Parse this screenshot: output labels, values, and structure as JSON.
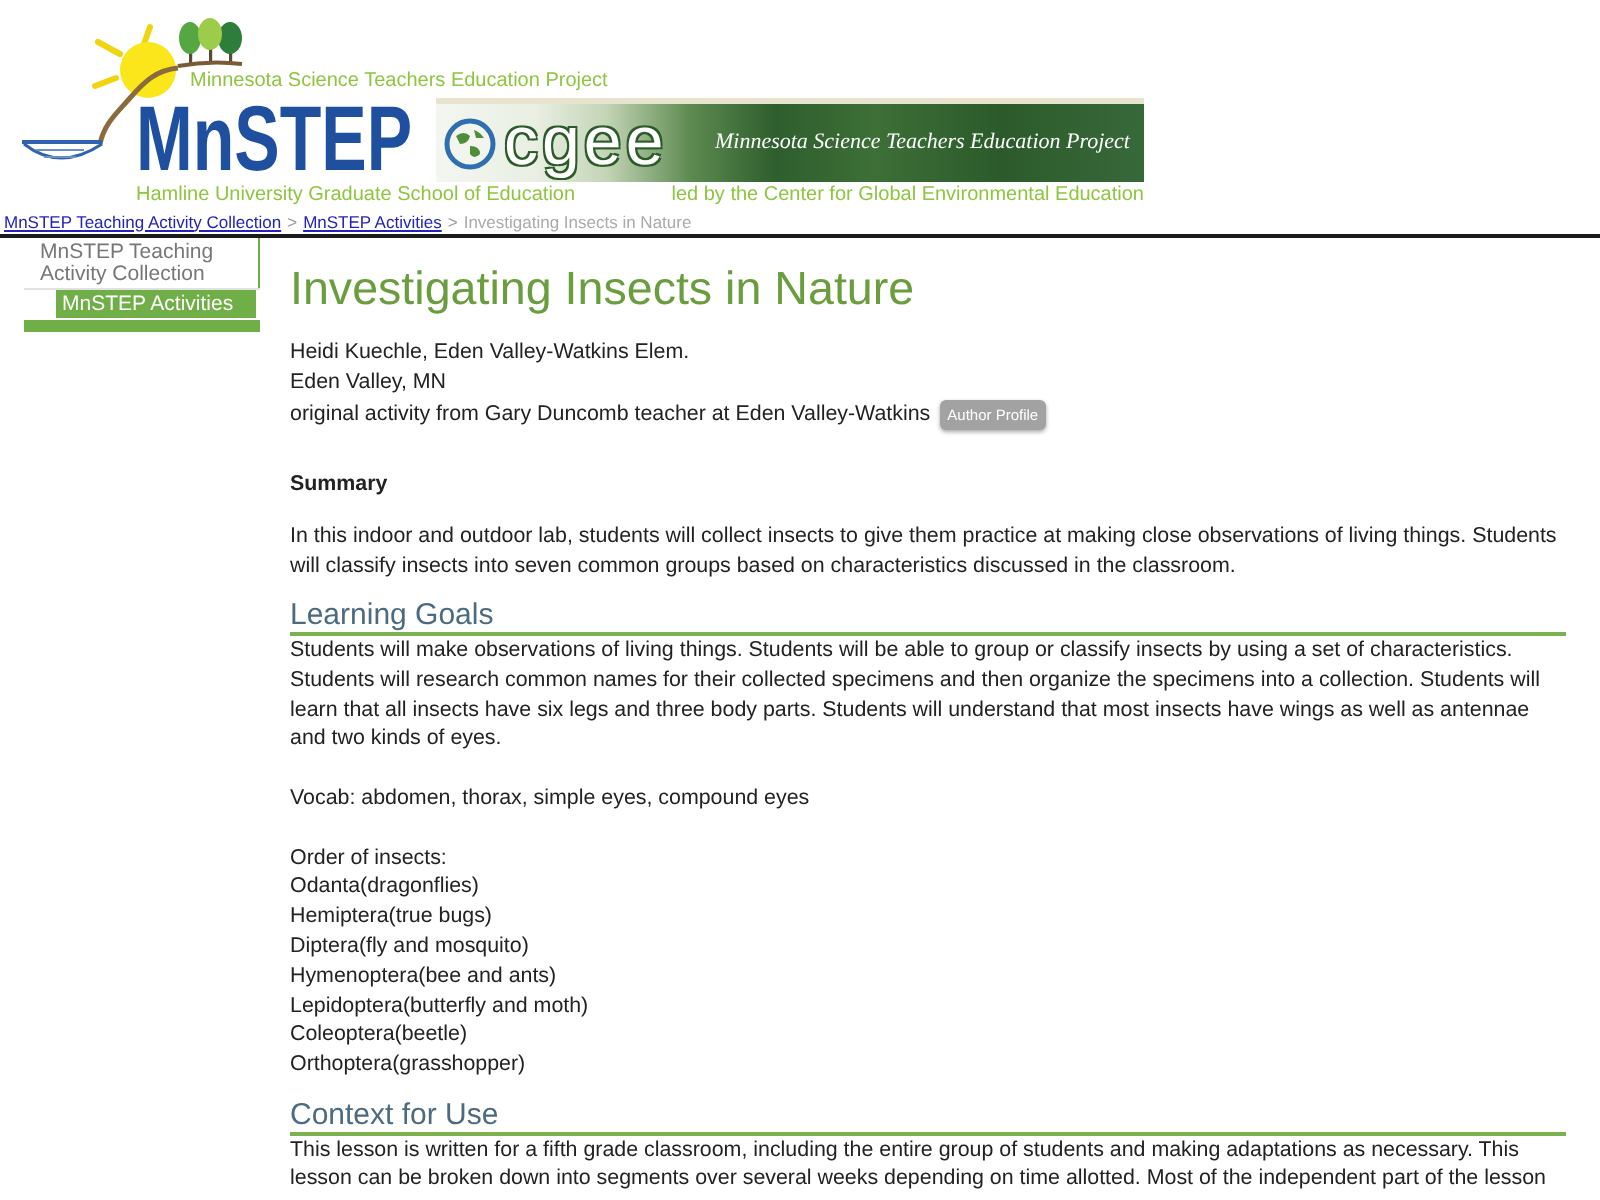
{
  "header": {
    "logo": {
      "tagline": "Minnesota Science Teachers Education Project",
      "name": "MnSTEP",
      "subtitle": "Hamline University Graduate School of Education"
    },
    "banner": {
      "logo_text": "cgee",
      "tagline": "Minnesota Science Teachers Education Project",
      "caption": "led by the Center for Global Environmental Education"
    }
  },
  "breadcrumb": [
    {
      "kind": "link",
      "label": "MnSTEP Teaching Activity Collection"
    },
    {
      "kind": "separator",
      "label": ">"
    },
    {
      "kind": "link",
      "label": "MnSTEP Activities"
    },
    {
      "kind": "separator",
      "label": ">"
    },
    {
      "kind": "current",
      "label": "Investigating Insects in Nature"
    }
  ],
  "sidebar": {
    "items": [
      {
        "label": "MnSTEP Teaching Activity Collection",
        "selected": false,
        "children": [
          {
            "label": "MnSTEP Activities",
            "selected": true
          }
        ]
      }
    ]
  },
  "title": "Investigating Insects in Nature",
  "byline": [
    {
      "text": "Heidi Kuechle, Eden Valley-Watkins Elem."
    },
    {
      "text": "Eden Valley, MN"
    },
    {
      "text": "original activity from Gary Duncomb teacher at Eden Valley-Watkins",
      "button": "Author Profile"
    }
  ],
  "sections": [
    {
      "kind": "minor",
      "heading": "Summary",
      "blocks": [
        {
          "kind": "paragraph",
          "text": "In this indoor and outdoor lab, students will collect insects to give them practice at making close observations of living things. Students will classify insects into seven common groups based on characteristics discussed in the classroom."
        }
      ]
    },
    {
      "kind": "major",
      "heading": "Learning Goals",
      "blocks": [
        {
          "kind": "paragraph",
          "text": "Students will make observations of living things. Students will be able to group or classify insects by using a set of characteristics. Students will research common names for their collected specimens and then organize the specimens into a collection. Students will learn that all insects have six legs and three body parts. Students will understand that most insects have wings as well as antennae and two kinds of eyes."
        },
        {
          "kind": "paragraph",
          "text": "Vocab: abdomen, thorax, simple eyes, compound eyes"
        },
        {
          "kind": "list",
          "heading": "Order of insects:",
          "items": [
            "Odanta(dragonflies)",
            "Hemiptera(true bugs)",
            "Diptera(fly and mosquito)",
            "Hymenoptera(bee and ants)",
            "Lepidoptera(butterfly and moth)",
            "Coleoptera(beetle)",
            "Orthoptera(grasshopper)"
          ]
        }
      ]
    },
    {
      "kind": "major",
      "heading": "Context for Use",
      "blocks": [
        {
          "kind": "paragraph",
          "text": "This lesson is written for a fifth grade classroom, including the entire group of students and making adaptations as necessary. This lesson can be broken down into segments over several weeks depending on time allotted. Most of the independent part of the lesson"
        }
      ]
    }
  ]
}
